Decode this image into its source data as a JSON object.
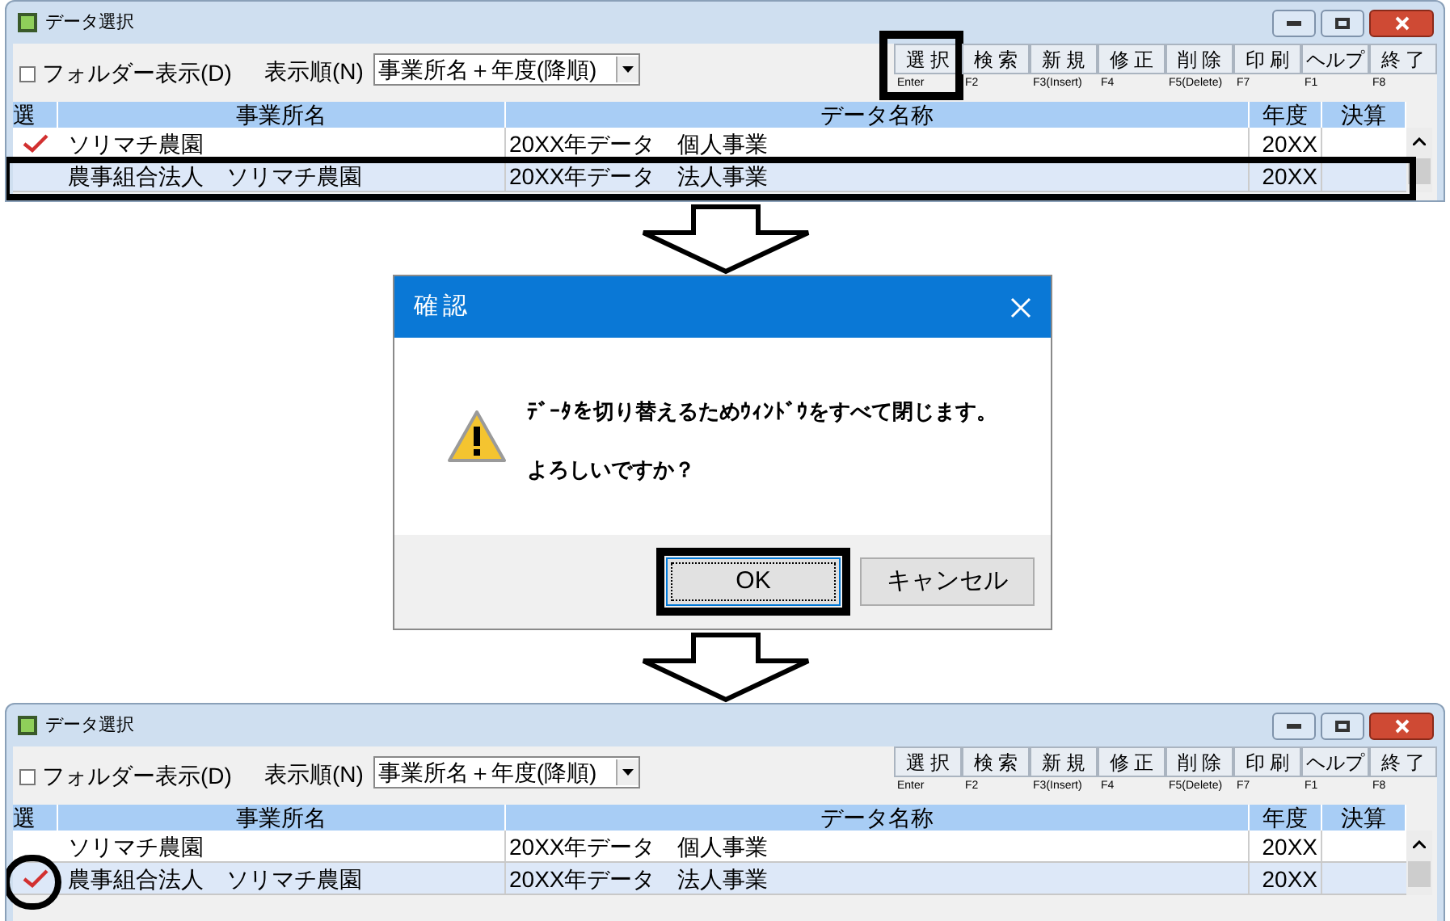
{
  "windows": [
    {
      "title": "データ選択",
      "folder_checkbox": {
        "label": "フォルダー表示(D)",
        "checked": false
      },
      "sort_label": "表示順(N)",
      "sort_select": {
        "value": "事業所名＋年度(降順)"
      },
      "toolbar": [
        {
          "label": "選 択",
          "key": "Enter",
          "callout": true
        },
        {
          "label": "検 索",
          "key": "F2",
          "callout": false
        },
        {
          "label": "新 規",
          "key": "F3(Insert)",
          "callout": false
        },
        {
          "label": "修 正",
          "key": "F4",
          "callout": false
        },
        {
          "label": "削 除",
          "key": "F5(Delete)",
          "callout": false
        },
        {
          "label": "印 刷",
          "key": "F7",
          "callout": false
        },
        {
          "label": "ヘルプ",
          "key": "F1",
          "callout": false
        },
        {
          "label": "終 了",
          "key": "F8",
          "callout": false
        }
      ],
      "columns": [
        "選",
        "事業所名",
        "データ名称",
        "年度",
        "決算"
      ],
      "rows": [
        {
          "office": "ソリマチ農園",
          "data_name": "20XX年データ　個人事業",
          "year": "20XX",
          "checked": true,
          "selected": false,
          "callout": false,
          "check_callout": false
        },
        {
          "office": "農事組合法人　ソリマチ農園",
          "data_name": "20XX年データ　法人事業",
          "year": "20XX",
          "checked": false,
          "selected": true,
          "callout": true,
          "check_callout": false
        }
      ]
    },
    {
      "title": "データ選択",
      "folder_checkbox": {
        "label": "フォルダー表示(D)",
        "checked": false
      },
      "sort_label": "表示順(N)",
      "sort_select": {
        "value": "事業所名＋年度(降順)"
      },
      "toolbar": [
        {
          "label": "選 択",
          "key": "Enter",
          "callout": false
        },
        {
          "label": "検 索",
          "key": "F2",
          "callout": false
        },
        {
          "label": "新 規",
          "key": "F3(Insert)",
          "callout": false
        },
        {
          "label": "修 正",
          "key": "F4",
          "callout": false
        },
        {
          "label": "削 除",
          "key": "F5(Delete)",
          "callout": false
        },
        {
          "label": "印 刷",
          "key": "F7",
          "callout": false
        },
        {
          "label": "ヘルプ",
          "key": "F1",
          "callout": false
        },
        {
          "label": "終 了",
          "key": "F8",
          "callout": false
        }
      ],
      "columns": [
        "選",
        "事業所名",
        "データ名称",
        "年度",
        "決算"
      ],
      "rows": [
        {
          "office": "ソリマチ農園",
          "data_name": "20XX年データ　個人事業",
          "year": "20XX",
          "checked": false,
          "selected": false,
          "callout": false,
          "check_callout": false
        },
        {
          "office": "農事組合法人　ソリマチ農園",
          "data_name": "20XX年データ　法人事業",
          "year": "20XX",
          "checked": true,
          "selected": true,
          "callout": false,
          "check_callout": true
        }
      ]
    }
  ],
  "dialog": {
    "title": "確認",
    "message": [
      "ﾃﾞｰﾀを切り替えるためｳｨﾝﾄﾞｳをすべて閉じます。",
      "よろしいですか？"
    ],
    "buttons": [
      {
        "label": "OK",
        "default": true,
        "callout": true
      },
      {
        "label": "キャンセル",
        "default": false,
        "callout": false
      }
    ]
  }
}
